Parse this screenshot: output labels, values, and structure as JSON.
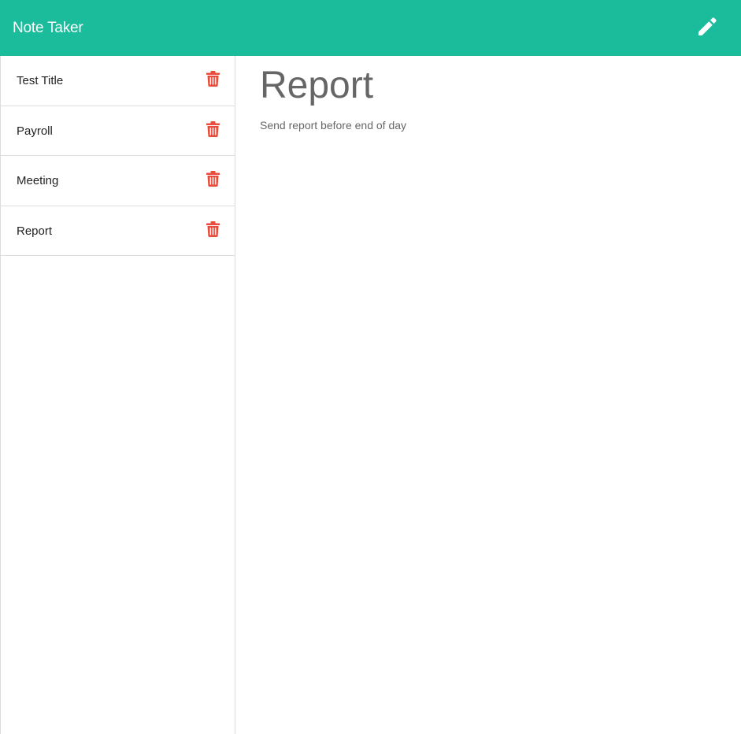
{
  "app": {
    "title": "Note Taker",
    "accent_color": "#1abc9c",
    "delete_color": "#e74c3c"
  },
  "header": {
    "new_note_icon": "pencil-icon"
  },
  "sidebar": {
    "notes": [
      {
        "title": "Test Title",
        "icon": "trash-icon"
      },
      {
        "title": "Payroll",
        "icon": "trash-icon"
      },
      {
        "title": "Meeting",
        "icon": "trash-icon"
      },
      {
        "title": "Report",
        "icon": "trash-icon"
      }
    ]
  },
  "main": {
    "note_title": "Report",
    "note_text": "Send report before end of day"
  }
}
